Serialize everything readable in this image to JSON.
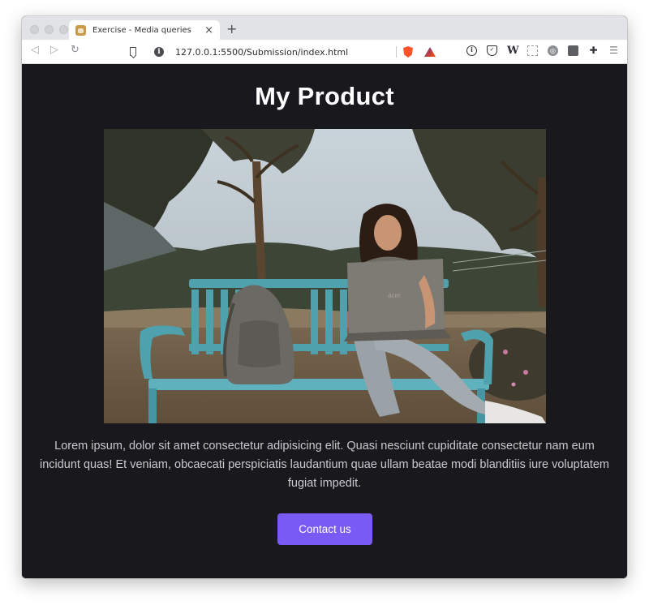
{
  "browser": {
    "tab": {
      "title": "Exercise - Media queries",
      "close": "×"
    },
    "new_tab": "+",
    "url": "127.0.0.1:5500/Submission/index.html",
    "accent": "#7a5af5"
  },
  "page": {
    "title": "My Product",
    "hero_image_alt": "Woman sitting on a teal park bench working on an acer laptop with a grey backpack beside her",
    "laptop_logo": "acer",
    "description": "Lorem ipsum, dolor sit amet consectetur adipisicing elit. Quasi nesciunt cupiditate consectetur nam eum incidunt quas! Et veniam, obcaecati perspiciatis laudantium quae ullam beatae modi blanditiis iure voluptatem fugiat impedit.",
    "contact_button": "Contact us",
    "background": "#19181d"
  }
}
